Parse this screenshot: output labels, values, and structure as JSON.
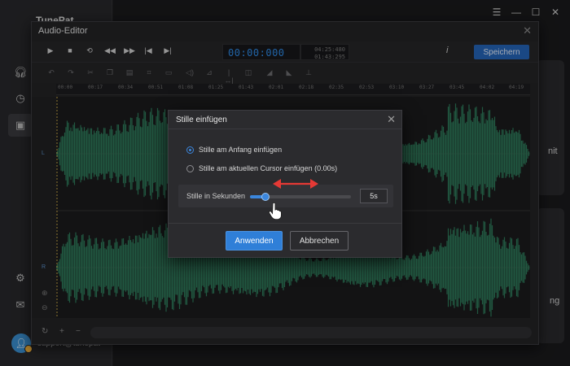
{
  "app": {
    "title": "TunePat",
    "user_email": "support@tunepat",
    "right_text_1": "nit",
    "right_text_2": "ng"
  },
  "window_controls": {
    "menu": "☰",
    "minimize": "—",
    "maximize": "☐",
    "close": "✕"
  },
  "sidebar_icons": [
    "headphones-icon",
    "clock-icon",
    "toolbox-icon",
    "gear-icon",
    "mail-icon"
  ],
  "editor": {
    "title": "Audio-Editor",
    "close": "✕",
    "time_main": "00:00:000",
    "time_total_1": "04:25:480",
    "time_total_2": "01:43:295",
    "info": "i",
    "save_label": "Speichern",
    "playback": [
      "▶",
      "■",
      "⟲",
      "◀◀",
      "▶▶",
      "|◀",
      "▶|"
    ],
    "ruler_ticks": [
      "00:00",
      "00:17",
      "00:34",
      "00:51",
      "01:08",
      "01:25",
      "01:43",
      "02:01",
      "02:18",
      "02:35",
      "02:53",
      "03:10",
      "03:27",
      "03:45",
      "04:02",
      "04:19"
    ],
    "channel_labels": [
      "L",
      "R"
    ]
  },
  "dialog": {
    "title": "Stille einfügen",
    "close": "✕",
    "option_start": "Stille am Anfang einfügen",
    "option_cursor": "Stille am aktuellen Cursor einfügen (0.00s)",
    "selected_option": "start",
    "silence_label": "Stille in Sekunden",
    "silence_value": "5s",
    "slider_fraction": 0.15,
    "apply_label": "Anwenden",
    "cancel_label": "Abbrechen"
  },
  "colors": {
    "accent": "#3b86dc",
    "save": "#2565b8",
    "wave": "#2f7a5a",
    "annotation": "#e53935"
  }
}
